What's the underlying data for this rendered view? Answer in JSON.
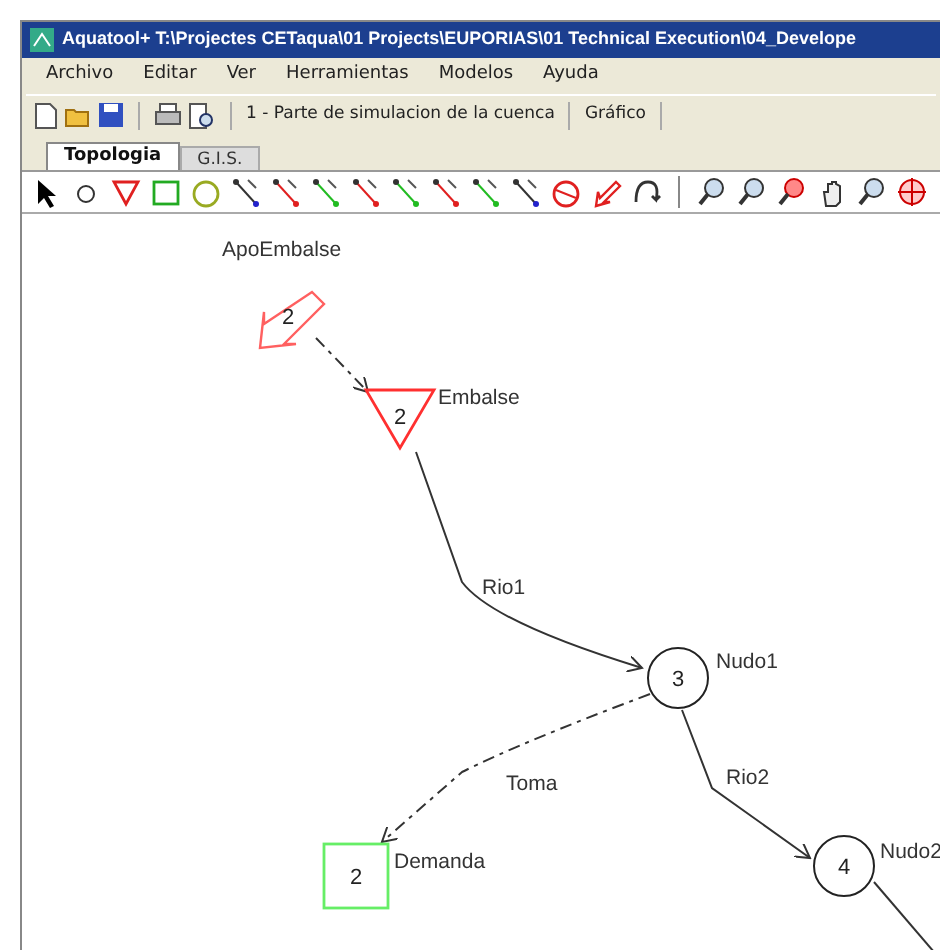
{
  "window": {
    "title": "Aquatool+ T:\\Projectes CETaqua\\01 Projects\\EUPORIAS\\01 Technical Execution\\04_Develope"
  },
  "menu": [
    "Archivo",
    "Editar",
    "Ver",
    "Herramientas",
    "Modelos",
    "Ayuda"
  ],
  "toolbar": {
    "items": [
      "1 - Parte de simulacion de la cuenca",
      "Gráfico"
    ]
  },
  "tabs": [
    {
      "label": "Topologia",
      "selected": true
    },
    {
      "label": "G.I.S.",
      "selected": false
    }
  ],
  "diagram": {
    "nodes": [
      {
        "kind": "inflow",
        "number": "2",
        "label": "ApoEmbalse"
      },
      {
        "kind": "reservoir",
        "number": "2",
        "label": "Embalse"
      },
      {
        "kind": "junction",
        "number": "3",
        "label": "Nudo1"
      },
      {
        "kind": "demand",
        "number": "2",
        "label": "Demanda"
      },
      {
        "kind": "junction",
        "number": "4",
        "label": "Nudo2"
      }
    ],
    "links": [
      {
        "kind": "dashed"
      },
      {
        "kind": "river",
        "label": "Rio1"
      },
      {
        "kind": "dashed",
        "label": "Toma"
      },
      {
        "kind": "river",
        "label": "Rio2"
      },
      {
        "kind": "river"
      }
    ]
  }
}
